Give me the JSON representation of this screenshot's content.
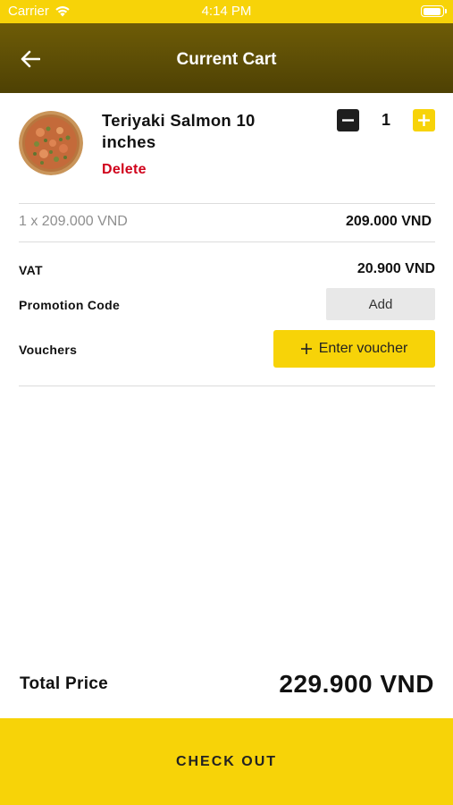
{
  "status_bar": {
    "carrier": "Carrier",
    "time": "4:14 PM"
  },
  "header": {
    "title": "Current Cart"
  },
  "cart_item": {
    "name": "Teriyaki Salmon 10 inches",
    "delete_label": "Delete",
    "quantity": "1",
    "unit_price_text": "1 x 209.000 VND",
    "line_total": "209.000 VND"
  },
  "summary": {
    "vat_label": "VAT",
    "vat_value": "20.900 VND",
    "promotion_label": "Promotion Code",
    "promotion_button": "Add",
    "vouchers_label": "Vouchers",
    "voucher_button": "Enter voucher"
  },
  "footer": {
    "total_label": "Total Price",
    "total_value": "229.900 VND",
    "checkout_label": "CHECK OUT"
  },
  "colors": {
    "accent": "#f7d308",
    "header": "#5c4c05",
    "delete": "#d0021b"
  }
}
